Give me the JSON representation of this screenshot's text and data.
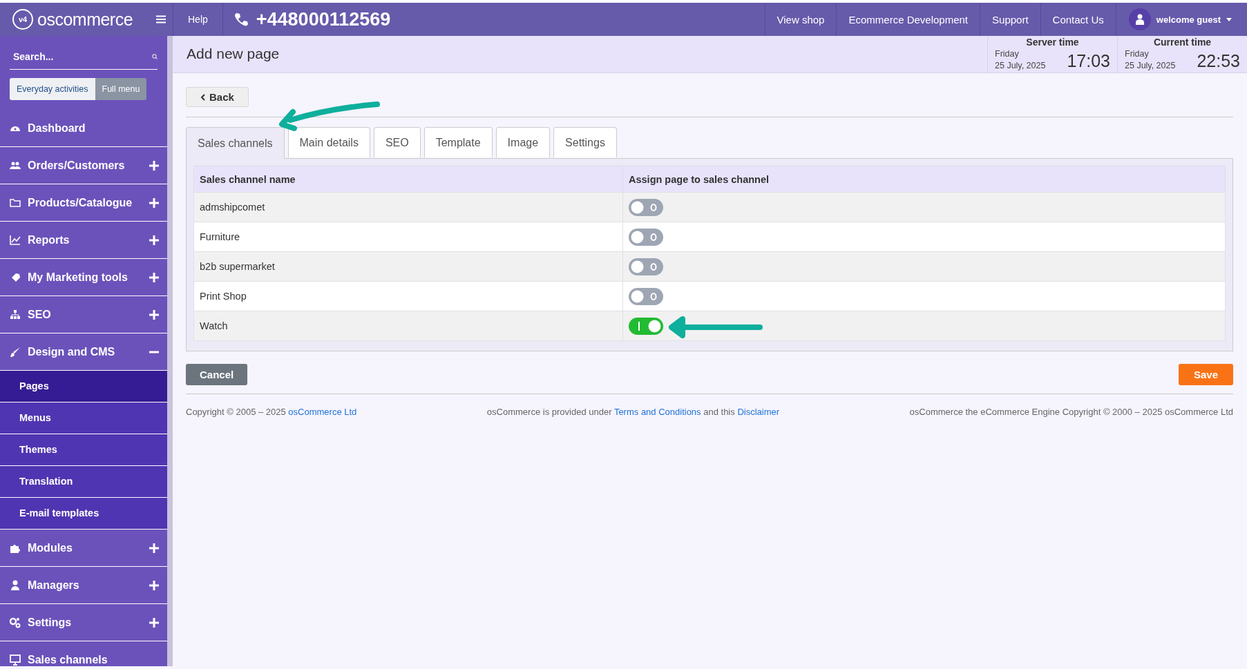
{
  "topbar": {
    "logo": {
      "badge": "v4",
      "text": "oscommerce"
    },
    "help": "Help",
    "phone": "+448000112569",
    "nav": [
      "View shop",
      "Ecommerce Development",
      "Support",
      "Contact Us"
    ],
    "user": "welcome guest"
  },
  "sidebar": {
    "search": {
      "placeholder": "Search..."
    },
    "modes": [
      {
        "label": "Everyday activities",
        "selected": true
      },
      {
        "label": "Full menu",
        "selected": false
      }
    ],
    "items": [
      {
        "label": "Dashboard",
        "kind": "link"
      },
      {
        "label": "Orders/Customers",
        "kind": "group",
        "expanded": false
      },
      {
        "label": "Products/Catalogue",
        "kind": "group",
        "expanded": false
      },
      {
        "label": "Reports",
        "kind": "group",
        "expanded": false
      },
      {
        "label": "My Marketing tools",
        "kind": "group",
        "expanded": false
      },
      {
        "label": "SEO",
        "kind": "group",
        "expanded": false
      },
      {
        "label": "Design and CMS",
        "kind": "group",
        "expanded": true,
        "children": [
          {
            "label": "Pages",
            "selected": true
          },
          {
            "label": "Menus",
            "selected": false
          },
          {
            "label": "Themes",
            "selected": false
          },
          {
            "label": "Translation",
            "selected": false
          },
          {
            "label": "E-mail templates",
            "selected": false
          }
        ]
      },
      {
        "label": "Modules",
        "kind": "group",
        "expanded": false
      },
      {
        "label": "Managers",
        "kind": "group",
        "expanded": false
      },
      {
        "label": "Settings",
        "kind": "group",
        "expanded": false
      },
      {
        "label": "Sales channels",
        "kind": "link"
      }
    ]
  },
  "page": {
    "title": "Add new page",
    "clocks": [
      {
        "label": "Server time",
        "day": "Friday",
        "date": "25 July, 2025",
        "time": "17:03"
      },
      {
        "label": "Current time",
        "day": "Friday",
        "date": "25 July, 2025",
        "time": "22:53"
      }
    ],
    "back": "Back",
    "tabs": [
      {
        "label": "Sales channels",
        "selected": true
      },
      {
        "label": "Main details",
        "selected": false
      },
      {
        "label": "SEO",
        "selected": false
      },
      {
        "label": "Template",
        "selected": false
      },
      {
        "label": "Image",
        "selected": false
      },
      {
        "label": "Settings",
        "selected": false
      }
    ],
    "table": {
      "columns": [
        "Sales channel name",
        "Assign page to sales channel"
      ],
      "rows": [
        {
          "name": "admshipcomet",
          "on": false
        },
        {
          "name": "Furniture",
          "on": false
        },
        {
          "name": "b2b supermarket",
          "on": false
        },
        {
          "name": "Print Shop",
          "on": false
        },
        {
          "name": "Watch",
          "on": true
        }
      ]
    },
    "cancel": "Cancel",
    "save": "Save"
  },
  "footer": [
    [
      {
        "kind": "text",
        "text": "Copyright © 2005 – 2025 "
      },
      {
        "kind": "link",
        "text": "osCommerce Ltd"
      }
    ],
    [
      {
        "kind": "text",
        "text": "osCommerce is provided under "
      },
      {
        "kind": "link",
        "text": "Terms and Conditions"
      },
      {
        "kind": "text",
        "text": " and this "
      },
      {
        "kind": "link",
        "text": "Disclaimer"
      }
    ],
    [
      {
        "kind": "text",
        "text": "osCommerce the eCommerce Engine Copyright © 2000 – 2025 osCommerce Ltd"
      }
    ]
  ]
}
